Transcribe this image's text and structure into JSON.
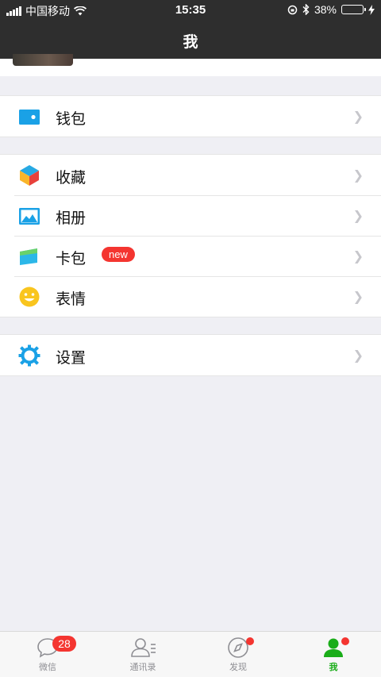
{
  "status": {
    "carrier": "中国移动",
    "time": "15:35",
    "battery": "38%",
    "battery_level": 0.38
  },
  "nav": {
    "title": "我"
  },
  "groups": [
    {
      "items": [
        {
          "label": "钱包",
          "icon": "wallet-icon",
          "color": "#1aa1e6"
        }
      ]
    },
    {
      "items": [
        {
          "label": "收藏",
          "icon": "favorites-icon"
        },
        {
          "label": "相册",
          "icon": "album-icon"
        },
        {
          "label": "卡包",
          "icon": "card-pack-icon",
          "badge": "new"
        },
        {
          "label": "表情",
          "icon": "sticker-icon"
        }
      ]
    },
    {
      "items": [
        {
          "label": "设置",
          "icon": "settings-icon"
        }
      ]
    }
  ],
  "tabs": [
    {
      "label": "微信",
      "icon": "chat-icon",
      "badge": "28"
    },
    {
      "label": "通讯录",
      "icon": "contacts-icon"
    },
    {
      "label": "发现",
      "icon": "discover-icon",
      "dot": true
    },
    {
      "label": "我",
      "icon": "me-icon",
      "active": true,
      "dot": true
    }
  ],
  "colors": {
    "accent": "#1aad19",
    "badge": "#f43530",
    "header": "#2e2e2e"
  }
}
